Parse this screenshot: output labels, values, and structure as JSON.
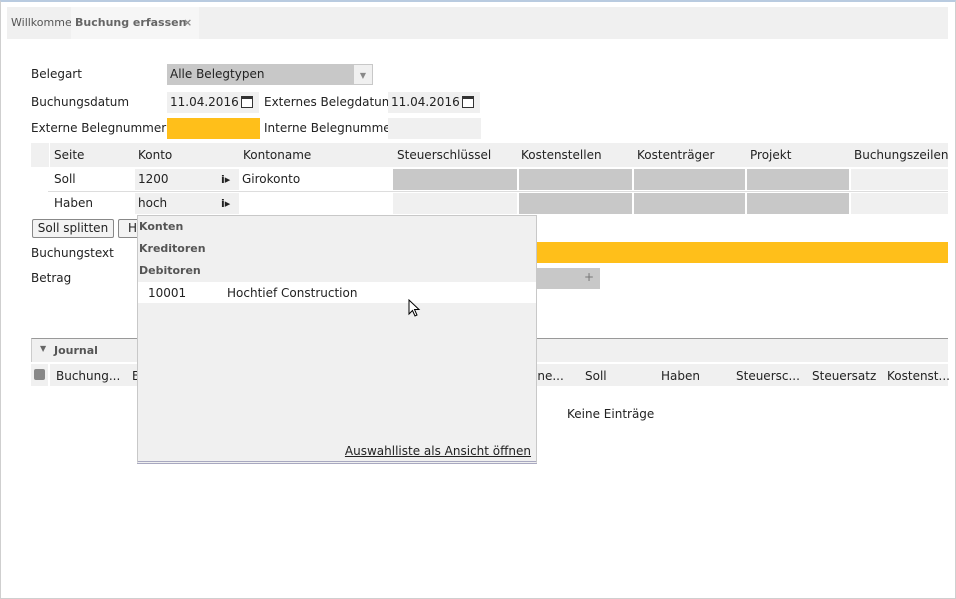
{
  "tabs": [
    {
      "label": "Willkommen"
    },
    {
      "label": "Buchung erfassen",
      "close": "×"
    }
  ],
  "form": {
    "belegart_label": "Belegart",
    "belegart_value": "Alle Belegtypen",
    "buchungsdatum_label": "Buchungsdatum",
    "buchungsdatum_value": "11.04.2016",
    "ext_belegdatum_label": "Externes Belegdatum",
    "ext_belegdatum_value": "11.04.2016",
    "ext_belegnr_label": "Externe Belegnummer",
    "ext_belegnr_value": "",
    "int_belegnr_label": "Interne Belegnummer",
    "int_belegnr_value": "",
    "buchungstext_label": "Buchungstext",
    "betrag_label": "Betrag",
    "betrag_plus": "+"
  },
  "grid": {
    "columns": [
      "Seite",
      "Konto",
      "Kontoname",
      "Steuerschlüssel",
      "Kostenstellen",
      "Kostenträger",
      "Projekt",
      "Buchungszeilentext"
    ],
    "rows": [
      {
        "seite": "Soll",
        "konto": "1200",
        "kontoname": "Girokonto"
      },
      {
        "seite": "Haben",
        "konto": "hoch",
        "kontoname": ""
      }
    ],
    "info_icon": "i▸"
  },
  "buttons": {
    "soll_splitten": "Soll splitten",
    "haben_splitten": "H"
  },
  "dropdown": {
    "groups": [
      "Konten",
      "Kreditoren",
      "Debitoren"
    ],
    "items": [
      {
        "number": "10001",
        "name": "Hochtief Construction"
      }
    ],
    "open_view_link": "Auswahlliste als Ansicht öffnen"
  },
  "journal": {
    "title": "Journal",
    "columns": [
      "Buchung...",
      "B",
      "one...",
      "Soll",
      "Haben",
      "Steuersc...",
      "Steuersatz",
      "Kostenst..."
    ],
    "empty": "Keine Einträge"
  },
  "colors": {
    "required": "#ffbf1a",
    "readonly": "#c8c8c8"
  }
}
